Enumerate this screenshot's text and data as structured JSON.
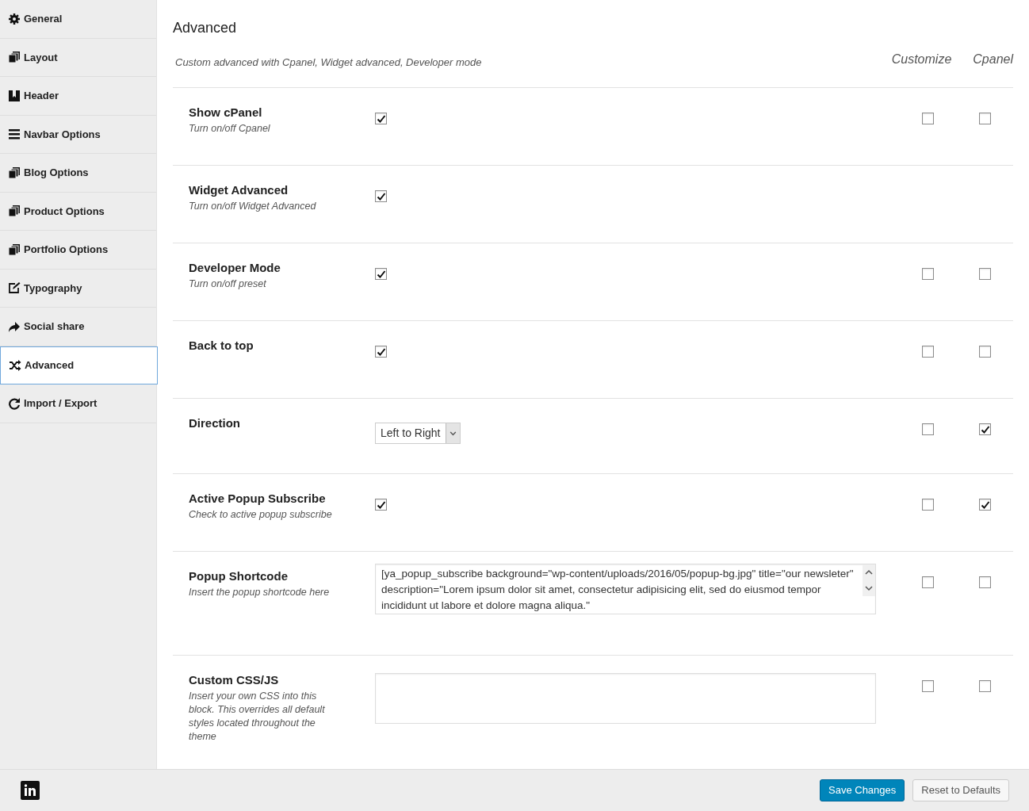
{
  "sidebar": {
    "items": [
      {
        "label": "General",
        "selected": false
      },
      {
        "label": "Layout",
        "selected": false
      },
      {
        "label": "Header",
        "selected": false
      },
      {
        "label": "Navbar Options",
        "selected": false
      },
      {
        "label": "Blog Options",
        "selected": false
      },
      {
        "label": "Product Options",
        "selected": false
      },
      {
        "label": "Portfolio Options",
        "selected": false
      },
      {
        "label": "Typography",
        "selected": false
      },
      {
        "label": "Social share",
        "selected": false
      },
      {
        "label": "Advanced",
        "selected": true
      },
      {
        "label": "Import / Export",
        "selected": false
      }
    ]
  },
  "section": {
    "title": "Advanced",
    "description": "Custom advanced with Cpanel, Widget advanced, Developer mode",
    "columns": [
      "Customize",
      "Cpanel"
    ]
  },
  "rows": [
    {
      "kind": "checkbox",
      "title": "Show cPanel",
      "subtitle": "Turn on/off Cpanel",
      "checked": true,
      "customize": false,
      "cpanel": false
    },
    {
      "kind": "checkbox",
      "title": "Widget Advanced",
      "subtitle": "Turn on/off Widget Advanced",
      "checked": true
    },
    {
      "kind": "checkbox",
      "title": "Developer Mode",
      "subtitle": "Turn on/off preset",
      "checked": true,
      "customize": false,
      "cpanel": false
    },
    {
      "kind": "checkbox",
      "title": "Back to top",
      "checked": true,
      "customize": false,
      "cpanel": false
    },
    {
      "kind": "select",
      "title": "Direction",
      "value": "Left to Right",
      "customize": false,
      "cpanel": true
    },
    {
      "kind": "checkbox",
      "title": "Active Popup Subscribe",
      "subtitle": "Check to active popup subscribe",
      "checked": true,
      "customize": false,
      "cpanel": true
    },
    {
      "kind": "textarea",
      "title": "Popup Shortcode",
      "subtitle": "Insert the popup shortcode here",
      "value": "[ya_popup_subscribe background=\"wp-content/uploads/2016/05/popup-bg.jpg\" title=\"our newsleter\" description=\"Lorem ipsum dolor sit amet, consectetur adipisicing elit, sed do eiusmod tempor incididunt ut labore et dolore magna aliqua.\"",
      "customize": false,
      "cpanel": false
    },
    {
      "kind": "textarea",
      "title": "Custom CSS/JS",
      "subtitle": "Insert your own CSS into this block. This overrides all default styles located throughout the theme",
      "customize": false,
      "cpanel": false
    }
  ],
  "footer": {
    "buttons": [
      {
        "label": "Save Changes",
        "kind": "primary"
      },
      {
        "label": "Reset to Defaults",
        "kind": "secondary"
      }
    ]
  }
}
